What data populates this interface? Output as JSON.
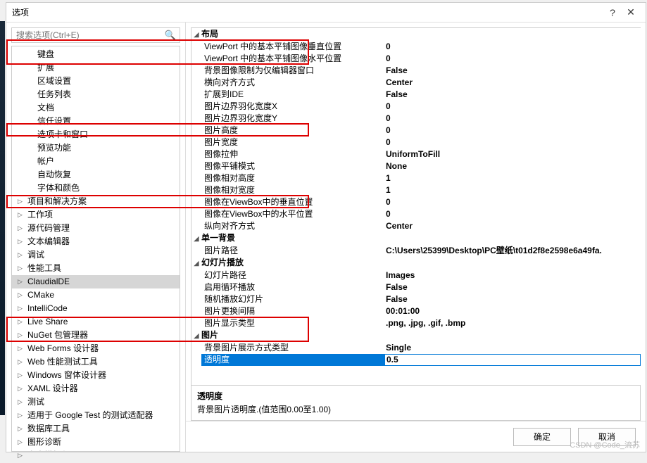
{
  "dialog": {
    "title": "选项",
    "help": "?",
    "close": "✕"
  },
  "search": {
    "placeholder": "搜索选项(Ctrl+E)"
  },
  "tree": {
    "plain": [
      "键盘",
      "扩展",
      "区域设置",
      "任务列表",
      "文档",
      "信任设置",
      "选项卡和窗口",
      "预览功能",
      "帐户",
      "自动恢复",
      "字体和颜色"
    ],
    "expandable": [
      "项目和解决方案",
      "工作项",
      "源代码管理",
      "文本编辑器",
      "调试",
      "性能工具",
      "ClaudialDE",
      "CMake",
      "IntelliCode",
      "Live Share",
      "NuGet 包管理器",
      "Web Forms 设计器",
      "Web 性能测试工具",
      "Windows 窗体设计器",
      "XAML 设计器",
      "测试",
      "适用于 Google Test 的测试适配器",
      "数据库工具",
      "图形诊断",
      "文本模板化"
    ],
    "selected": "ClaudialDE"
  },
  "props": {
    "cat1": "布局",
    "r1": {
      "l": "ViewPort 中的基本平铺图像垂直位置",
      "v": "0"
    },
    "r2": {
      "l": "ViewPort 中的基本平铺图像水平位置",
      "v": "0"
    },
    "r3": {
      "l": "背景图像限制为仅编辑器窗口",
      "v": "False"
    },
    "r4": {
      "l": "横向对齐方式",
      "v": "Center"
    },
    "r5": {
      "l": "扩展到IDE",
      "v": "False"
    },
    "r6": {
      "l": "图片边界羽化宽度X",
      "v": "0"
    },
    "r7": {
      "l": "图片边界羽化宽度Y",
      "v": "0"
    },
    "r8": {
      "l": "图片高度",
      "v": "0"
    },
    "r9": {
      "l": "图片宽度",
      "v": "0"
    },
    "r10": {
      "l": "图像拉伸",
      "v": "UniformToFill"
    },
    "r11": {
      "l": "图像平铺模式",
      "v": "None"
    },
    "r12": {
      "l": "图像相对高度",
      "v": "1"
    },
    "r13": {
      "l": "图像相对宽度",
      "v": "1"
    },
    "r14": {
      "l": "图像在ViewBox中的垂直位置",
      "v": "0"
    },
    "r15": {
      "l": "图像在ViewBox中的水平位置",
      "v": "0"
    },
    "r16": {
      "l": "纵向对齐方式",
      "v": "Center"
    },
    "cat2": "单一背景",
    "r17": {
      "l": "图片路径",
      "v": "C:\\Users\\25399\\Desktop\\PC壁纸\\t01d2f8e2598e6a49fa."
    },
    "cat3": "幻灯片播放",
    "r18": {
      "l": "幻灯片路径",
      "v": "Images"
    },
    "r19": {
      "l": "启用循环播放",
      "v": "False"
    },
    "r20": {
      "l": "随机播放幻灯片",
      "v": "False"
    },
    "r21": {
      "l": "图片更换间隔",
      "v": "00:01:00"
    },
    "r22": {
      "l": "图片显示类型",
      "v": ".png, .jpg, .gif, .bmp"
    },
    "cat4": "图片",
    "r23": {
      "l": "背景图片展示方式类型",
      "v": "Single"
    },
    "r24": {
      "l": "透明度",
      "v": "0.5"
    }
  },
  "desc": {
    "title": "透明度",
    "text": "背景图片透明度.(值范围0.00至1.00)"
  },
  "footer": {
    "ok": "确定",
    "cancel": "取消"
  },
  "watermark": "CSDN @Code_流苏"
}
